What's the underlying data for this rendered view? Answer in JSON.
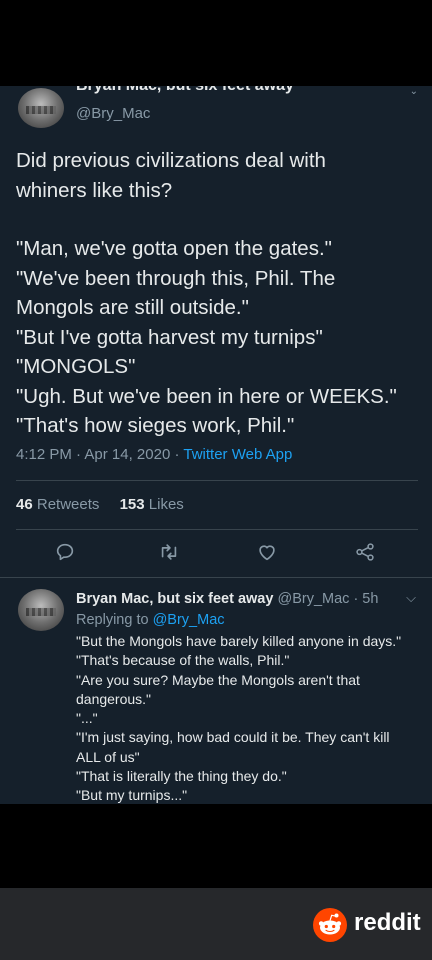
{
  "tweet": {
    "author_name": "Bryan Mac, but six feet away",
    "handle": "@Bry_Mac",
    "text_lines": [
      "Did previous civilizations deal with",
      "whiners like this?",
      "",
      "\"Man, we've gotta open the gates.\"",
      "\"We've been through this, Phil. The",
      "Mongols are still outside.\"",
      "\"But I've gotta harvest my turnips\"",
      "\"MONGOLS\"",
      "\"Ugh. But we've been in here or WEEKS.\"",
      "\"That's how sieges work, Phil.\""
    ],
    "time": "4:12 PM",
    "date": "Apr 14, 2020",
    "source": "Twitter Web App",
    "retweets_count": "46",
    "retweets_label": "Retweets",
    "likes_count": "153",
    "likes_label": "Likes"
  },
  "actions": [
    {
      "name": "reply-icon"
    },
    {
      "name": "retweet-icon"
    },
    {
      "name": "like-icon"
    },
    {
      "name": "share-icon"
    }
  ],
  "reply": {
    "author_name": "Bryan Mac, but six feet away",
    "handle": "@Bry_Mac",
    "age": "5h",
    "replying_prefix": "Replying to",
    "replying_handle": "@Bry_Mac",
    "text_lines": [
      "\"But the Mongols have barely killed anyone in days.\"",
      "\"That's because of the walls, Phil.\"",
      "\"Are you sure? Maybe the Mongols aren't that",
      "dangerous.\"",
      "\"...\"",
      "\"I'm just saying, how bad could it be. They can't kill",
      "ALL of us\"",
      "\"That is literally the thing they do.\"",
      "\"But my turnips...\""
    ]
  },
  "watermark": {
    "label": "reddit"
  },
  "colors": {
    "background": "#15202b",
    "text": "#e6e9ea",
    "secondary": "#8899a6",
    "accent": "#1da1f2",
    "reddit": "#ff4500"
  }
}
